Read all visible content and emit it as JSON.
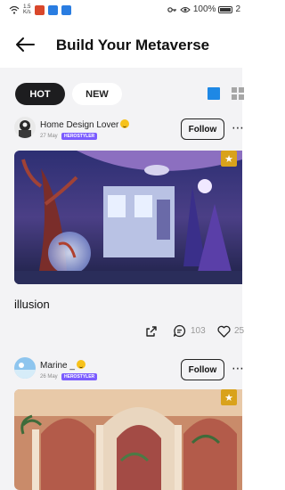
{
  "status_bar": {
    "speed_value": "1.5",
    "speed_unit": "K/s",
    "battery": "100%",
    "time_fragment": "2"
  },
  "header": {
    "title": "Build Your Metaverse"
  },
  "tabs": [
    {
      "label": "HOT",
      "active": true
    },
    {
      "label": "NEW",
      "active": false
    }
  ],
  "posts": [
    {
      "username": "Home Design Lover",
      "date": "27 May",
      "badge": "HEROSTYLER",
      "follow_label": "Follow",
      "caption": "illusion",
      "shares": "",
      "comments": "103",
      "likes": "25"
    },
    {
      "username": "Marine _",
      "date": "26 May",
      "badge": "HEROSTYLER",
      "follow_label": "Follow"
    }
  ],
  "colors": {
    "accent_blue": "#1e88e5",
    "badge_purple": "#7b5cff",
    "pin_gold": "#d9a21b",
    "tab_active_bg": "#1d1d1f"
  }
}
